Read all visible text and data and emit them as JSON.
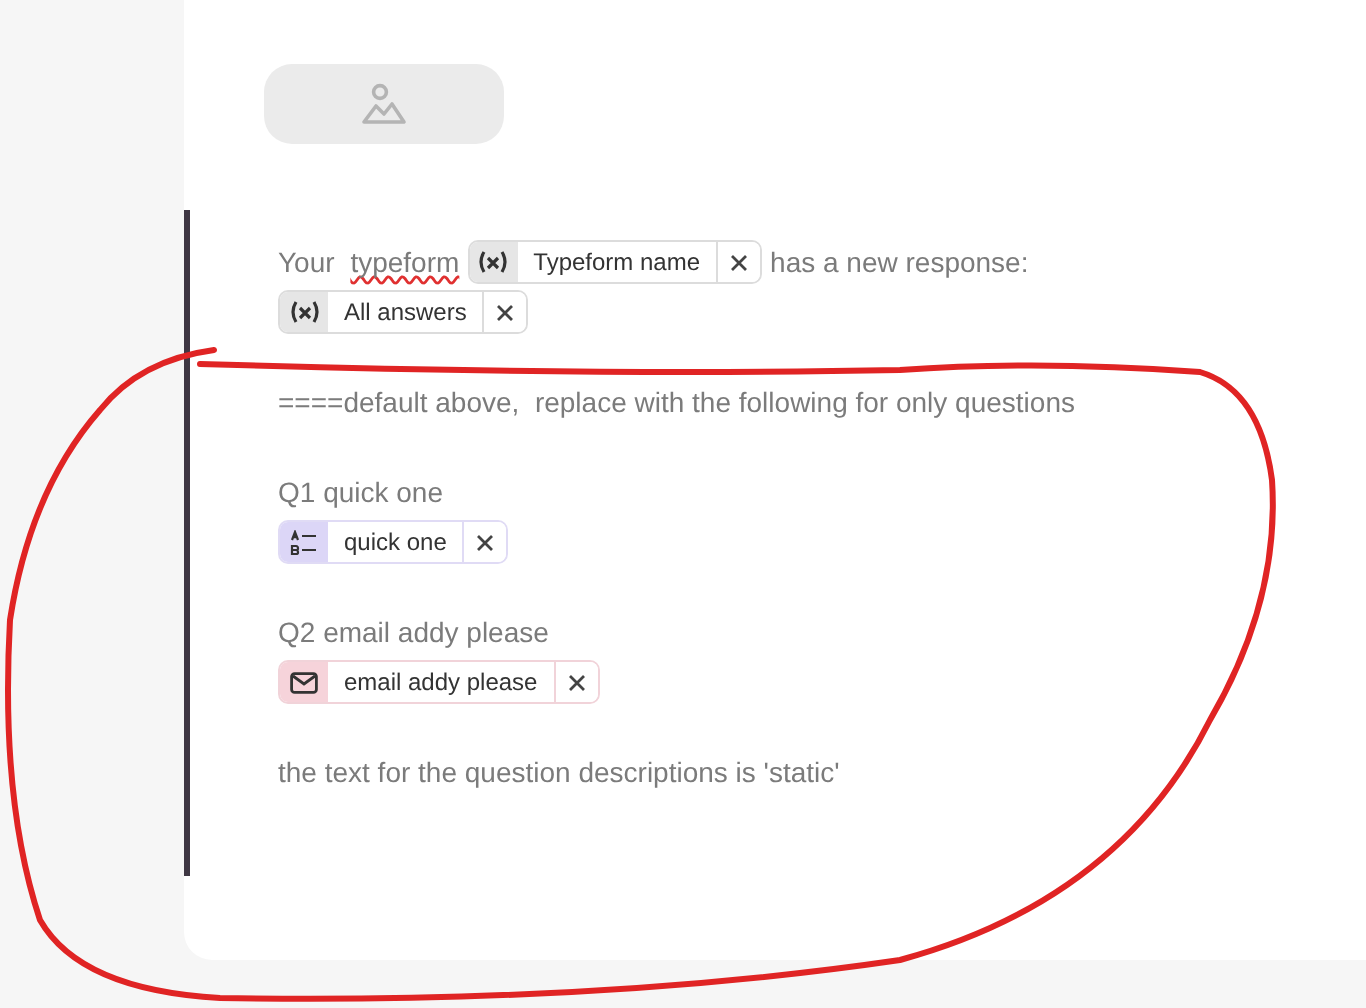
{
  "paragraphs": [
    {
      "lines": [
        {
          "segments": [
            {
              "kind": "text",
              "text": "Your "
            },
            {
              "kind": "text",
              "text": "typeform",
              "misspelled": true
            },
            {
              "kind": "variable_chip",
              "label": "Typeform name"
            },
            {
              "kind": "text",
              "text": "has a new response:"
            }
          ]
        },
        {
          "segments": [
            {
              "kind": "variable_chip",
              "label": "All answers"
            }
          ]
        }
      ]
    },
    {
      "lines": [
        {
          "segments": [
            {
              "kind": "text",
              "text": "====default above,  replace with the following for only questions"
            }
          ]
        }
      ]
    },
    {
      "lines": [
        {
          "segments": [
            {
              "kind": "text",
              "text": "Q1 quick one"
            }
          ]
        },
        {
          "segments": [
            {
              "kind": "short_text_chip",
              "label": "quick one"
            }
          ]
        }
      ]
    },
    {
      "lines": [
        {
          "segments": [
            {
              "kind": "text",
              "text": "Q2 email addy please"
            }
          ]
        },
        {
          "segments": [
            {
              "kind": "email_chip",
              "label": "email addy please"
            }
          ]
        }
      ]
    },
    {
      "lines": [
        {
          "segments": [
            {
              "kind": "text",
              "text": "the text for the question descriptions is 'static'"
            }
          ]
        }
      ]
    }
  ]
}
